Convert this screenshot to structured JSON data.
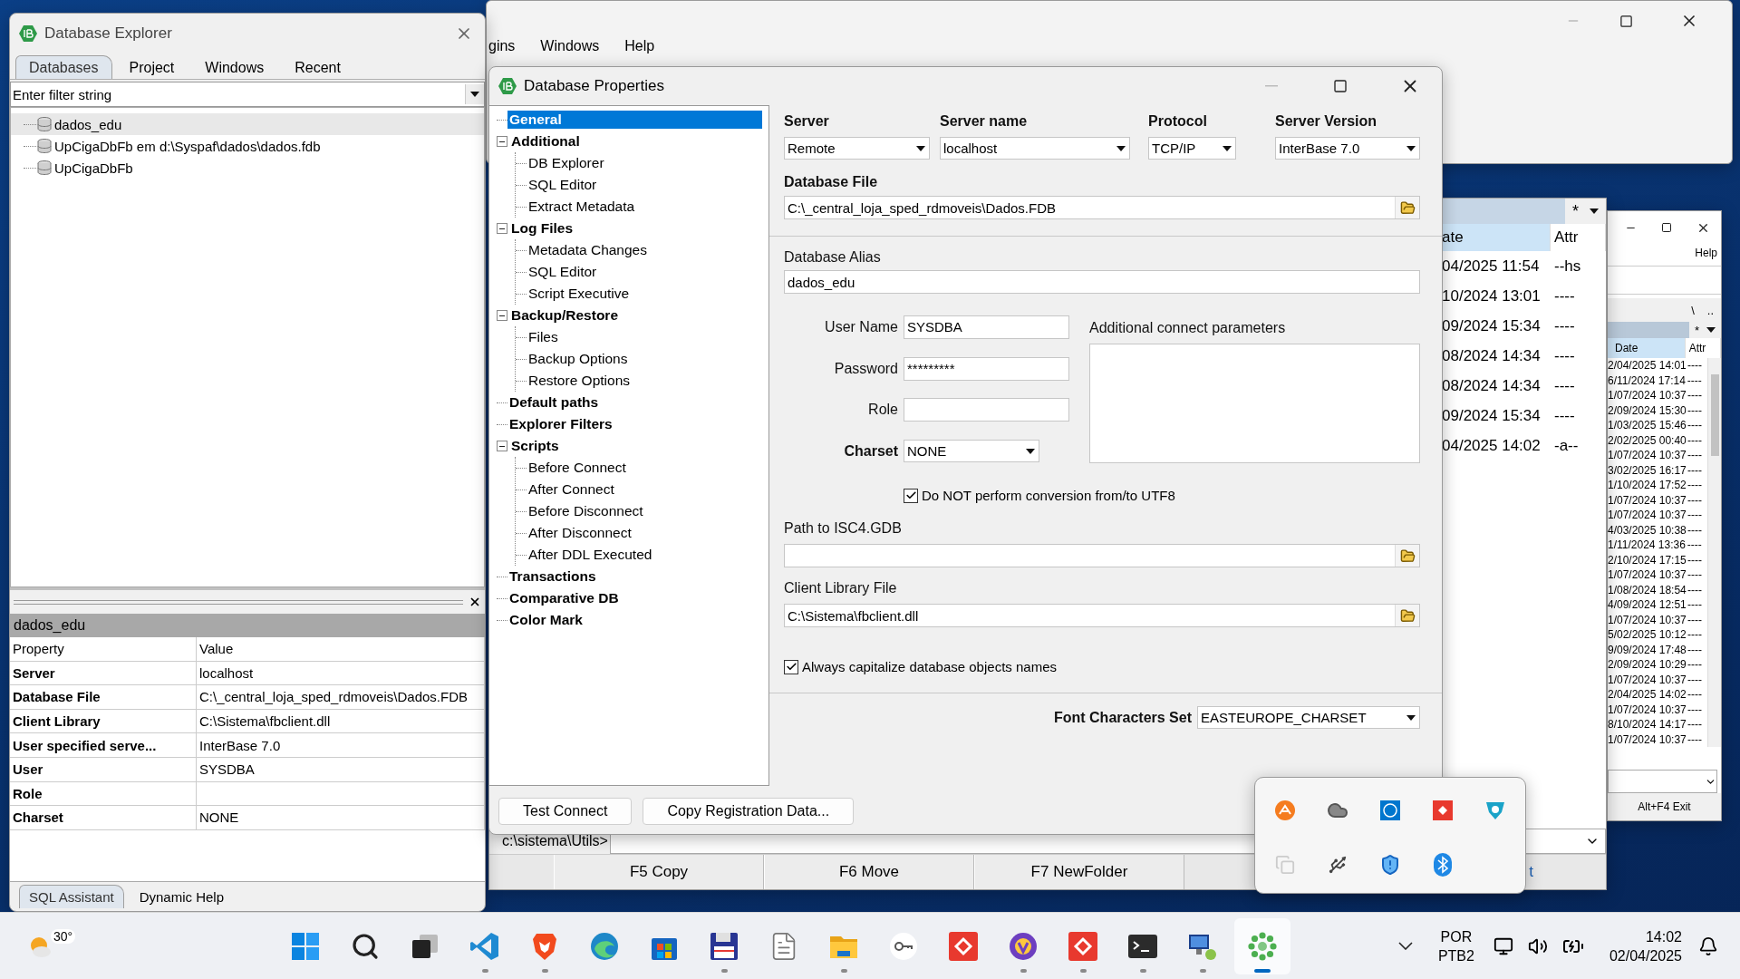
{
  "background_window": {
    "menu": [
      "gins",
      "Windows",
      "Help"
    ]
  },
  "file_manager": {
    "filter": "*",
    "columns": [
      "ate",
      "Attr"
    ],
    "rows": [
      {
        "date": "04/2025 11:54",
        "attr": "--hs"
      },
      {
        "date": "10/2024 13:01",
        "attr": "----"
      },
      {
        "date": "09/2024 15:34",
        "attr": "----"
      },
      {
        "date": "08/2024 14:34",
        "attr": "----"
      },
      {
        "date": "08/2024 14:34",
        "attr": "----"
      },
      {
        "date": "09/2024 15:34",
        "attr": "----"
      },
      {
        "date": "04/2025 14:02",
        "attr": "-a--"
      }
    ],
    "command_path": "c:\\sistema\\Utils>",
    "function_keys": [
      "F5 Copy",
      "F6 Move",
      "F7 NewFolder"
    ],
    "link_fragment": "t"
  },
  "small_file_manager": {
    "menu": [
      "Help"
    ],
    "path_buttons": [
      "\\",
      ".."
    ],
    "filter": "*",
    "columns": [
      "Date",
      "Attr"
    ],
    "rows": [
      {
        "date": "2/04/2025 14:01",
        "attr": "----"
      },
      {
        "date": "6/11/2024 17:14",
        "attr": "----"
      },
      {
        "date": "1/07/2024 10:37",
        "attr": "----"
      },
      {
        "date": "2/09/2024 15:30",
        "attr": "----"
      },
      {
        "date": "1/03/2025 15:46",
        "attr": "----"
      },
      {
        "date": "2/02/2025 00:40",
        "attr": "----"
      },
      {
        "date": "1/07/2024 10:37",
        "attr": "----"
      },
      {
        "date": "3/02/2025 16:17",
        "attr": "----"
      },
      {
        "date": "1/10/2024 17:52",
        "attr": "----"
      },
      {
        "date": "1/07/2024 10:37",
        "attr": "----"
      },
      {
        "date": "1/07/2024 10:37",
        "attr": "----"
      },
      {
        "date": "4/03/2025 10:38",
        "attr": "----"
      },
      {
        "date": "1/11/2024 13:36",
        "attr": "----"
      },
      {
        "date": "2/10/2024 17:15",
        "attr": "----"
      },
      {
        "date": "1/07/2024 10:37",
        "attr": "----"
      },
      {
        "date": "1/08/2024 18:54",
        "attr": "----"
      },
      {
        "date": "4/09/2024 12:51",
        "attr": "----"
      },
      {
        "date": "1/07/2024 10:37",
        "attr": "----"
      },
      {
        "date": "5/02/2025 10:12",
        "attr": "----"
      },
      {
        "date": "9/09/2024 17:48",
        "attr": "----"
      },
      {
        "date": "2/09/2024 10:29",
        "attr": "----"
      },
      {
        "date": "1/07/2024 10:37",
        "attr": "----"
      },
      {
        "date": "2/04/2025 14:02",
        "attr": "----"
      },
      {
        "date": "1/07/2024 10:37",
        "attr": "----"
      },
      {
        "date": "8/10/2024 14:17",
        "attr": "----"
      },
      {
        "date": "1/07/2024 10:37",
        "attr": "----"
      }
    ],
    "function_keys": [
      "Alt+F4 Exit"
    ]
  },
  "database_explorer": {
    "title": "Database Explorer",
    "tabs": [
      {
        "label": "Databases",
        "selected": true
      },
      {
        "label": "Project",
        "selected": false
      },
      {
        "label": "Windows",
        "selected": false
      },
      {
        "label": "Recent",
        "selected": false
      }
    ],
    "filter": {
      "placeholder": "Enter filter string"
    },
    "databases": [
      {
        "name": "dados_edu",
        "selected": true
      },
      {
        "name": "UpCigaDbFb em d:\\Syspaf\\dados\\dados.fdb",
        "selected": false
      },
      {
        "name": "UpCigaDbFb",
        "selected": false
      }
    ],
    "properties": {
      "title": "dados_edu",
      "columns": [
        "Property",
        "Value"
      ],
      "rows": [
        {
          "property": "Server",
          "value": "localhost"
        },
        {
          "property": "Database File",
          "value": "C:\\_central_loja_sped_rdmoveis\\Dados.FDB"
        },
        {
          "property": "Client Library",
          "value": "C:\\Sistema\\fbclient.dll"
        },
        {
          "property": "User specified serve...",
          "value": "InterBase 7.0"
        },
        {
          "property": "User",
          "value": "SYSDBA"
        },
        {
          "property": "Role",
          "value": ""
        },
        {
          "property": "Charset",
          "value": "NONE"
        }
      ]
    },
    "bottom_tabs": [
      {
        "label": "SQL Assistant",
        "selected": true
      },
      {
        "label": "Dynamic Help",
        "selected": false
      }
    ]
  },
  "database_properties": {
    "title": "Database Properties",
    "tree": [
      {
        "label": "General",
        "selected": true
      },
      {
        "label": "Additional",
        "selected": false,
        "expanded": true,
        "children": [
          {
            "label": "DB Explorer",
            "selected": false
          },
          {
            "label": "SQL Editor",
            "selected": false
          },
          {
            "label": "Extract Metadata",
            "selected": false
          }
        ]
      },
      {
        "label": "Log Files",
        "selected": false,
        "expanded": true,
        "children": [
          {
            "label": "Metadata Changes",
            "selected": false
          },
          {
            "label": "SQL Editor",
            "selected": false
          },
          {
            "label": "Script Executive",
            "selected": false
          }
        ]
      },
      {
        "label": "Backup/Restore",
        "selected": false,
        "expanded": true,
        "children": [
          {
            "label": "Files",
            "selected": false
          },
          {
            "label": "Backup Options",
            "selected": false
          },
          {
            "label": "Restore Options",
            "selected": false
          }
        ]
      },
      {
        "label": "Default paths",
        "selected": false
      },
      {
        "label": "Explorer Filters",
        "selected": false
      },
      {
        "label": "Scripts",
        "selected": false,
        "expanded": true,
        "children": [
          {
            "label": "Before Connect",
            "selected": false
          },
          {
            "label": "After Connect",
            "selected": false
          },
          {
            "label": "Before Disconnect",
            "selected": false
          },
          {
            "label": "After Disconnect",
            "selected": false
          },
          {
            "label": "After DDL Executed",
            "selected": false
          }
        ]
      },
      {
        "label": "Transactions",
        "selected": false
      },
      {
        "label": "Comparative DB",
        "selected": false
      },
      {
        "label": "Color Mark",
        "selected": false
      }
    ],
    "connection": [
      {
        "label": "Server",
        "value": "Remote"
      },
      {
        "label": "Server name",
        "value": "localhost"
      },
      {
        "label": "Protocol",
        "value": "TCP/IP"
      },
      {
        "label": "Server Version",
        "value": "InterBase 7.0"
      }
    ],
    "database_file": {
      "label": "Database File",
      "value": "C:\\_central_loja_sped_rdmoveis\\Dados.FDB"
    },
    "database_alias": {
      "label": "Database Alias",
      "value": "dados_edu"
    },
    "login": [
      {
        "label": "User Name",
        "value": "SYSDBA",
        "kind": "text",
        "emphasized": false
      },
      {
        "label": "Password",
        "value": "*********",
        "kind": "text",
        "emphasized": false
      },
      {
        "label": "Role",
        "kind": "text",
        "emphasized": false
      },
      {
        "label": "Charset",
        "value": "NONE",
        "kind": "combo",
        "emphasized": true
      }
    ],
    "additional_params": {
      "label": "Additional connect parameters"
    },
    "utf8_option": {
      "label": "Do NOT perform conversion from/to UTF8",
      "checked": true
    },
    "isc4_path": {
      "label": "Path to ISC4.GDB"
    },
    "client_library": {
      "label": "Client Library File",
      "value": "C:\\Sistema\\fbclient.dll"
    },
    "capitalize_option": {
      "label": "Always capitalize database objects names",
      "checked": true
    },
    "font_charset": {
      "label": "Font Characters Set",
      "value": "EASTEUROPE_CHARSET"
    },
    "buttons": [
      "Test Connect",
      "Copy Registration Data..."
    ]
  },
  "tray_popup": {
    "icons": [
      {
        "kind": "orange-badge"
      },
      {
        "kind": "cloud"
      },
      {
        "kind": "blue-square"
      },
      {
        "kind": "red-diamond"
      },
      {
        "kind": "teal-shield"
      },
      {
        "kind": "copy"
      },
      {
        "kind": "usb"
      },
      {
        "kind": "shield-warning"
      },
      {
        "kind": "bluetooth"
      }
    ]
  },
  "taskbar": {
    "weather": {
      "temperature": "30°"
    },
    "apps": [
      {
        "kind": "start",
        "running": false,
        "active": false
      },
      {
        "kind": "search",
        "running": false,
        "active": false
      },
      {
        "kind": "task-view",
        "running": false,
        "active": false
      },
      {
        "kind": "code-editor",
        "running": true,
        "active": false
      },
      {
        "kind": "lion-browser",
        "running": true,
        "active": false
      },
      {
        "kind": "wave-browser",
        "running": false,
        "active": false
      },
      {
        "kind": "store",
        "running": false,
        "active": false
      },
      {
        "kind": "floppy",
        "running": true,
        "active": false
      },
      {
        "kind": "document",
        "running": false,
        "active": false
      },
      {
        "kind": "folder",
        "running": true,
        "active": false
      },
      {
        "kind": "key",
        "running": false,
        "active": false
      },
      {
        "kind": "red-diamond",
        "running": false,
        "active": false
      },
      {
        "kind": "vpn",
        "running": true,
        "active": false
      },
      {
        "kind": "red-diamond",
        "running": true,
        "active": false
      },
      {
        "kind": "terminal",
        "running": true,
        "active": false
      },
      {
        "kind": "computer",
        "running": true,
        "active": false
      },
      {
        "kind": "green-dots",
        "running": true,
        "active": true
      }
    ],
    "language": [
      "POR",
      "PTB2"
    ],
    "clock": {
      "time": "14:02",
      "date": "02/04/2025"
    }
  }
}
